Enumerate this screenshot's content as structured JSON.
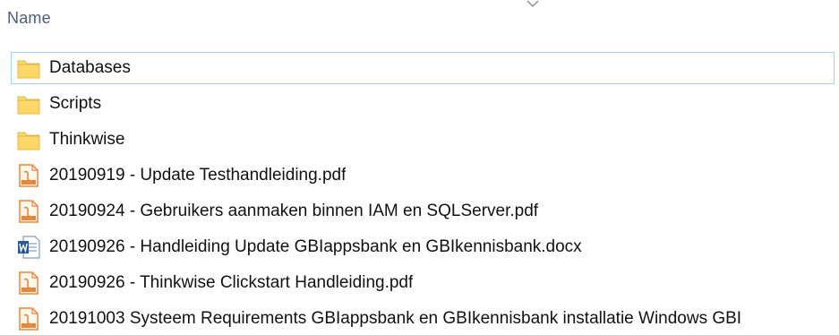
{
  "header": {
    "name_column": "Name"
  },
  "colors": {
    "header_text": "#4c607a",
    "selection_border": "#99d1ff",
    "folder_yellow": "#ffd766",
    "pdf_orange": "#e8863a",
    "word_blue": "#2b579a"
  },
  "files": [
    {
      "label": "Databases",
      "icon": "folder-icon",
      "selected": true
    },
    {
      "label": "Scripts",
      "icon": "folder-icon"
    },
    {
      "label": "Thinkwise",
      "icon": "folder-icon"
    },
    {
      "label": "20190919 - Update Testhandleiding.pdf",
      "icon": "pdf-icon"
    },
    {
      "label": "20190924 - Gebruikers aanmaken binnen IAM en SQLServer.pdf",
      "icon": "pdf-icon"
    },
    {
      "label": "20190926 - Handleiding Update GBIappsbank en GBIkennisbank.docx",
      "icon": "word-doc-icon"
    },
    {
      "label": "20190926 - Thinkwise Clickstart Handleiding.pdf",
      "icon": "pdf-icon"
    },
    {
      "label": "20191003 Systeem Requirements GBIappsbank en GBIkennisbank installatie Windows GBI",
      "icon": "pdf-icon"
    }
  ]
}
